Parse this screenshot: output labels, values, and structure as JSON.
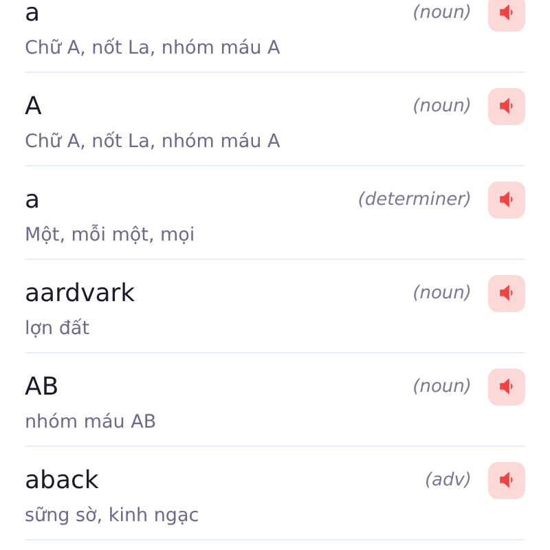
{
  "entries": [
    {
      "word": "a",
      "pos": "(noun)",
      "meaning": "Chữ A, nốt La, nhóm máu A"
    },
    {
      "word": "A",
      "pos": "(noun)",
      "meaning": "Chữ A, nốt La, nhóm máu A"
    },
    {
      "word": "a",
      "pos": "(determiner)",
      "meaning": "Một, mỗi một, mọi"
    },
    {
      "word": "aardvark",
      "pos": "(noun)",
      "meaning": "lợn đất"
    },
    {
      "word": "AB",
      "pos": "(noun)",
      "meaning": "nhóm máu AB"
    },
    {
      "word": "aback",
      "pos": "(adv)",
      "meaning": "sững sờ, kinh ngạc"
    }
  ]
}
